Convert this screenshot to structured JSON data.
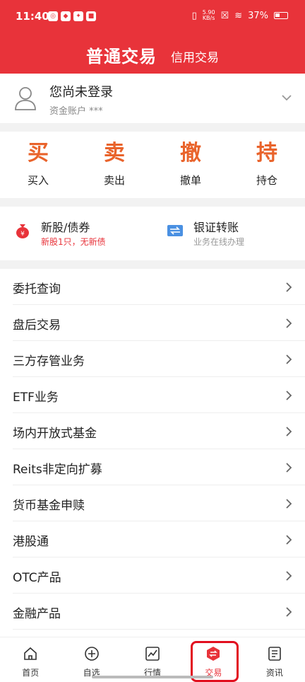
{
  "status_bar": {
    "time": "11:40",
    "net_speed_value": "5.90",
    "net_speed_unit": "KB/s",
    "battery": "37%"
  },
  "header": {
    "title": "普通交易",
    "tab_credit": "信用交易"
  },
  "account": {
    "name": "您尚未登录",
    "sub": "资金账户 ***"
  },
  "quick_actions": [
    {
      "glyph": "买",
      "label": "买入"
    },
    {
      "glyph": "卖",
      "label": "卖出"
    },
    {
      "glyph": "撤",
      "label": "撤单"
    },
    {
      "glyph": "持",
      "label": "持仓"
    }
  ],
  "services": {
    "ipo": {
      "title": "新股/债券",
      "sub": "新股1只，无新债",
      "sub_color": "#e8333a"
    },
    "transfer": {
      "title": "银证转账",
      "sub": "业务在线办理",
      "sub_color": "#999999"
    }
  },
  "menu": [
    "委托查询",
    "盘后交易",
    "三方存管业务",
    "ETF业务",
    "场内开放式基金",
    "Reits非定向扩募",
    "货币基金申赎",
    "港股通",
    "OTC产品",
    "金融产品"
  ],
  "tabbar": [
    {
      "label": "首页",
      "icon": "home-icon"
    },
    {
      "label": "自选",
      "icon": "plus-circle-icon"
    },
    {
      "label": "行情",
      "icon": "chart-icon"
    },
    {
      "label": "交易",
      "icon": "trade-icon"
    },
    {
      "label": "资讯",
      "icon": "news-icon"
    }
  ],
  "colors": {
    "brand": "#e8333a",
    "accent": "#e9632b"
  }
}
